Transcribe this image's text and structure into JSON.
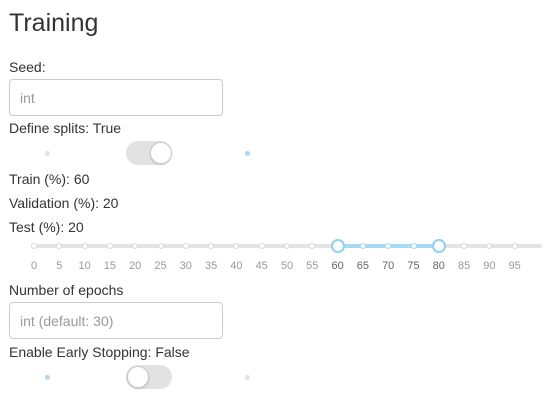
{
  "page": {
    "title": "Training"
  },
  "seed": {
    "label": "Seed:",
    "value": "",
    "placeholder": "int"
  },
  "define_splits": {
    "label": "Define splits: True",
    "enabled": true
  },
  "splits": {
    "train_label": "Train (%): 60",
    "validation_label": "Validation (%): 20",
    "test_label": "Test (%): 20",
    "slider": {
      "ticks": [
        "0",
        "5",
        "10",
        "15",
        "20",
        "25",
        "30",
        "35",
        "40",
        "45",
        "50",
        "55",
        "60",
        "65",
        "70",
        "75",
        "80",
        "85",
        "90",
        "95"
      ],
      "min": 0,
      "max": 100,
      "step": 5,
      "handle_low": 60,
      "handle_high": 80,
      "active_color": "#a8daf3",
      "rail_color": "#e4e4e4"
    }
  },
  "epochs": {
    "label": "Number of epochs",
    "value": "",
    "placeholder": "int (default: 30)"
  },
  "early_stopping": {
    "label": "Enable Early Stopping: False",
    "enabled": false
  }
}
